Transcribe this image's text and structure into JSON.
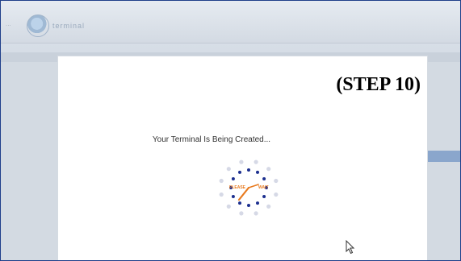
{
  "app": {
    "header_faint_text": "...",
    "logo_text": "terminal",
    "logo_icon": "globe-logo-icon"
  },
  "modal": {
    "step_label": "(STEP 10)",
    "status_text": "Your Terminal Is Being Created...",
    "spinner_icon": "loading-dots-clock-icon",
    "spinner_caption_left": "PLEASE",
    "spinner_caption_right": "WAIT"
  },
  "cursor": {
    "icon": "mouse-pointer-icon"
  },
  "colors": {
    "spinner_dot": "#1c2f8f",
    "spinner_faint": "#d6d9e6",
    "spinner_hand": "#e87a1e",
    "frame_border": "#1f3f8a"
  }
}
